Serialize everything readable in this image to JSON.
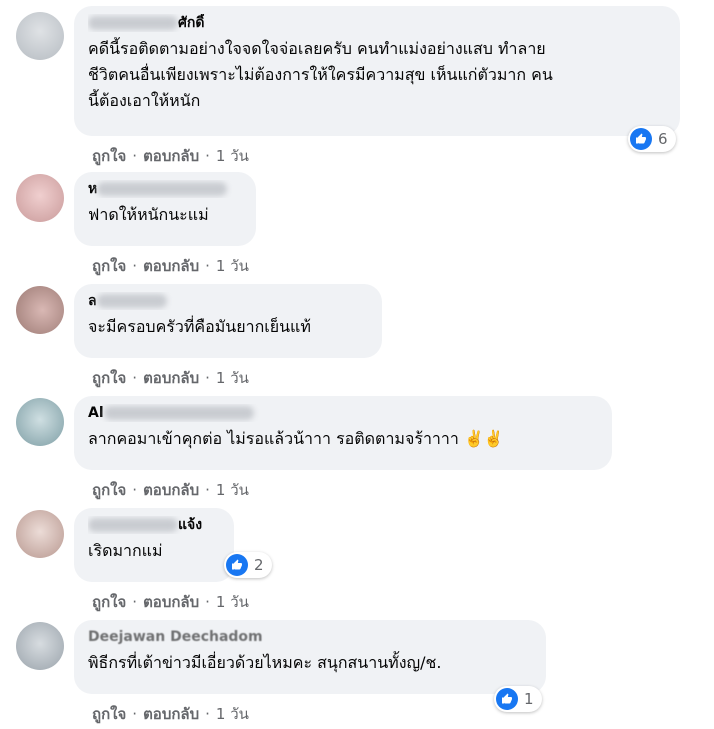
{
  "comments": [
    {
      "name_visible": "ศักดิ์",
      "text": "คดีนี้รอติดตามอย่างใจจดใจจ่อเลยครับ คนทำแม่งอย่างแสบ ทำลาย\nชีวิตคนอื่นเพียงเพราะไม่ต้องการให้ใครมีความสุข เห็นแก่ตัวมาก คน\nนี้ต้องเอาให้หนัก",
      "reactions": "6",
      "like": "ถูกใจ",
      "reply": "ตอบกลับ",
      "time": "1 วัน",
      "avatar_color": "#c8cdd2"
    },
    {
      "name_visible": "ห",
      "text": "ฟาดให้หนักนะแม่",
      "reactions": "",
      "like": "ถูกใจ",
      "reply": "ตอบกลับ",
      "time": "1 วัน",
      "avatar_color": "#e2b6b6"
    },
    {
      "name_visible": "ล",
      "text": "จะมีครอบครัวที่คือมันยากเย็นแท้",
      "reactions": "",
      "like": "ถูกใจ",
      "reply": "ตอบกลับ",
      "time": "1 วัน",
      "avatar_color": "#c9a7a3"
    },
    {
      "name_visible": "Al",
      "text": "ลากคอมาเข้าคุกต่อ ไม่รอแล้วน้าาา รอติดตามจร้าาาา ✌️✌️",
      "reactions": "",
      "like": "ถูกใจ",
      "reply": "ตอบกลับ",
      "time": "1 วัน",
      "avatar_color": "#9fb7bd"
    },
    {
      "name_visible": "แจ้ง",
      "text": "เริดมากแม่",
      "reactions": "2",
      "like": "ถูกใจ",
      "reply": "ตอบกลับ",
      "time": "1 วัน",
      "avatar_color": "#d8c2bc"
    },
    {
      "name_visible": "Deejawan Deechadom",
      "text": "พิธีกรที่เต้าข่าวมีเอี่ยวด้วยไหมคะ สนุกสนานทั้งญ/ช.",
      "reactions": "1",
      "like": "ถูกใจ",
      "reply": "ตอบกลับ",
      "time": "1 วัน",
      "avatar_color": "#b9c0c7"
    }
  ]
}
